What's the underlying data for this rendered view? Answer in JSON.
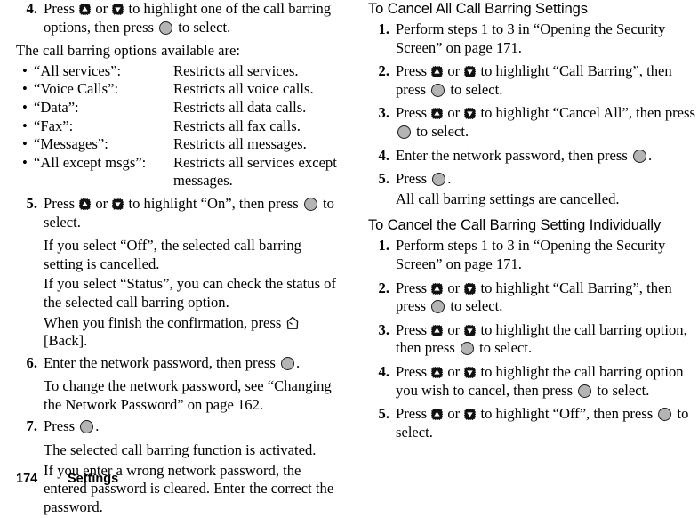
{
  "page": {
    "number": "174",
    "chapter": "Settings"
  },
  "icons": {
    "up": "nav-up-key-icon",
    "down": "nav-down-key-icon",
    "select": "center-select-key-icon",
    "softkey_left": "left-softkey-icon"
  },
  "left_column": {
    "step4": {
      "num": "4.",
      "text_a": "Press ",
      "text_b": " or ",
      "text_c": " to highlight one of the call barring options, then press ",
      "text_d": " to select."
    },
    "intro": "The call barring options available are:",
    "bullets": [
      {
        "term": "“All services”:",
        "def": "Restricts all services."
      },
      {
        "term": "“Voice Calls”:",
        "def": "Restricts all voice calls."
      },
      {
        "term": "“Data”:",
        "def": "Restricts all data calls."
      },
      {
        "term": "“Fax”:",
        "def": "Restricts all fax calls."
      },
      {
        "term": "“Messages”:",
        "def": "Restricts all messages."
      },
      {
        "term": "“All except msgs”:",
        "def": "Restricts all services except",
        "def2": "messages."
      }
    ],
    "step5": {
      "num": "5.",
      "text_a": "Press ",
      "text_b": " or ",
      "text_c": " to highlight “On”, then press ",
      "text_d": " to select.",
      "note1": "If you select “Off”, the selected call barring setting is cancelled.",
      "note2": "If you select “Status”, you can check the status of the selected call barring option.",
      "note3_a": "When you finish the confirmation, press ",
      "note3_b": " [Back]."
    },
    "step6": {
      "num": "6.",
      "text_a": "Enter the network password, then press ",
      "text_b": ".",
      "note": "To change the network password, see “Changing the Network Password” on page 162."
    },
    "step7": {
      "num": "7.",
      "text_a": "Press ",
      "text_b": ".",
      "note1": "The selected call barring function is activated.",
      "note2": "If you enter a wrong network password, the entered password is cleared. Enter the correct the password."
    }
  },
  "right_column": {
    "heading1": "To Cancel All Call Barring Settings",
    "s1": {
      "num": "1.",
      "text": "Perform steps 1 to 3 in “Opening the Security Screen” on page 171."
    },
    "s2": {
      "num": "2.",
      "text_a": "Press ",
      "text_b": " or ",
      "text_c": " to highlight “Call Barring”, then press ",
      "text_d": " to select."
    },
    "s3": {
      "num": "3.",
      "text_a": "Press ",
      "text_b": " or ",
      "text_c": " to highlight “Cancel All”, then press ",
      "text_d": " to select."
    },
    "s4": {
      "num": "4.",
      "text_a": "Enter the network password, then press ",
      "text_b": "."
    },
    "s5": {
      "num": "5.",
      "text_a": "Press ",
      "text_b": ".",
      "note": "All call barring settings are cancelled."
    },
    "heading2": "To Cancel the Call Barring Setting Individually",
    "t1": {
      "num": "1.",
      "text": "Perform steps 1 to 3 in “Opening the Security Screen” on page 171."
    },
    "t2": {
      "num": "2.",
      "text_a": "Press ",
      "text_b": " or ",
      "text_c": " to highlight “Call Barring”, then press ",
      "text_d": " to select."
    },
    "t3": {
      "num": "3.",
      "text_a": "Press ",
      "text_b": " or ",
      "text_c": " to highlight the call barring option, then press ",
      "text_d": " to select."
    },
    "t4": {
      "num": "4.",
      "text_a": "Press ",
      "text_b": " or ",
      "text_c": " to highlight the call barring option you wish to cancel, then press ",
      "text_d": " to select."
    },
    "t5": {
      "num": "5.",
      "text_a": "Press ",
      "text_b": " or ",
      "text_c": " to highlight “Off”, then press ",
      "text_d": " to select."
    }
  }
}
